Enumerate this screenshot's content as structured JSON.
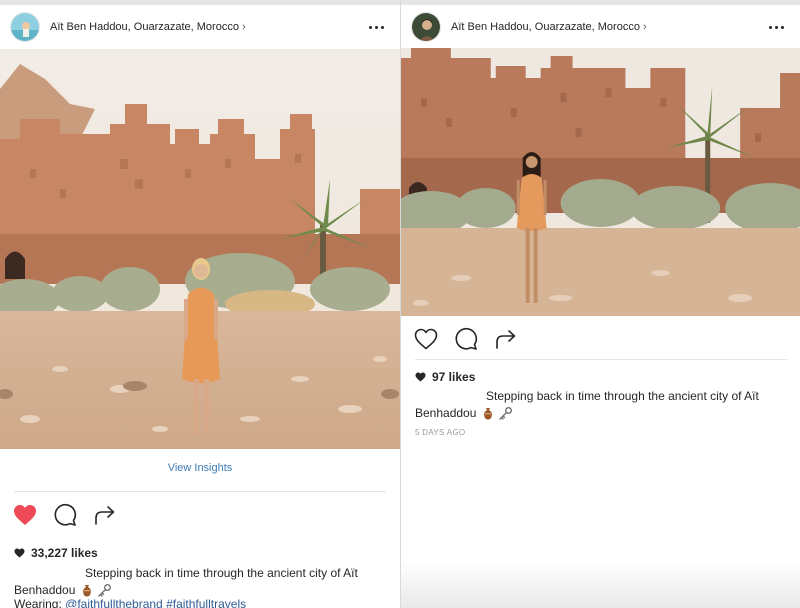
{
  "left_post": {
    "location": "Aït Ben Haddou, Ouarzazate, Morocco",
    "chevron": "›",
    "liked": true,
    "view_insights": "View Insights",
    "likes": "33,227 likes",
    "caption_line1": "Stepping back in time through the ancient city of Aït",
    "caption_line2": "Benhaddou",
    "wearing_label": "Wearing:",
    "wearing_tags": "@faithfullthebrand #faithfulltravels",
    "icons": [
      "more-icon",
      "heart-filled-icon",
      "comment-icon",
      "share-icon",
      "mini-heart-icon",
      "amphora-emoji-icon",
      "key-emoji-icon"
    ]
  },
  "right_post": {
    "location": "Aït Ben Haddou, Ouarzazate, Morocco",
    "chevron": "›",
    "liked": false,
    "likes": "97 likes",
    "caption_line1": "Stepping back in time through the ancient city of Aït",
    "caption_line2": "Benhaddou",
    "time_ago": "5 DAYS AGO",
    "icons": [
      "more-icon",
      "heart-outline-icon",
      "comment-icon",
      "share-icon",
      "mini-heart-icon",
      "amphora-emoji-icon",
      "key-emoji-icon"
    ]
  },
  "colors": {
    "like_red": "#ed4956",
    "link_blue": "#3f7bb5",
    "tag_blue": "#2f5c96",
    "text": "#262626",
    "muted": "#999999"
  }
}
